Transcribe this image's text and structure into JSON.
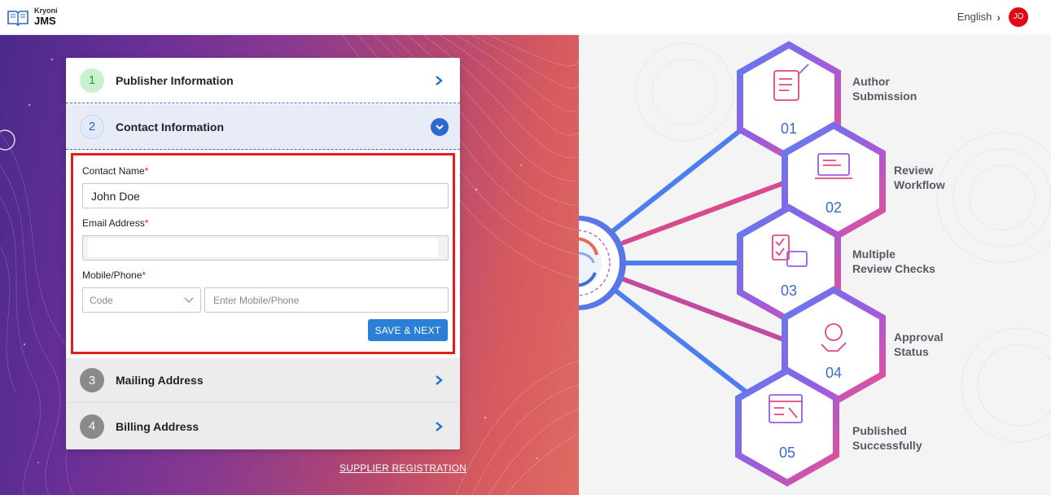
{
  "header": {
    "brand_sub": "Kryoni",
    "brand_main": "JMS",
    "language": "English",
    "avatar_initials": "JO"
  },
  "steps": [
    {
      "number": "1",
      "label": "Publisher Information"
    },
    {
      "number": "2",
      "label": "Contact Information"
    },
    {
      "number": "3",
      "label": "Mailing Address"
    },
    {
      "number": "4",
      "label": "Billing Address"
    }
  ],
  "form": {
    "contact_name_label": "Contact Name",
    "contact_name_value": "John Doe",
    "email_label": "Email Address",
    "email_value": "",
    "phone_label": "Mobile/Phone",
    "code_placeholder": "Code",
    "phone_placeholder": "Enter Mobile/Phone",
    "required_mark": "*",
    "save_label": "SAVE & NEXT"
  },
  "footer_link": "SUPPLIER REGISTRATION",
  "workflow": [
    {
      "num": "01",
      "line1": "Author",
      "line2": "Submission",
      "icon": "scroll-quill-icon"
    },
    {
      "num": "02",
      "line1": "Review",
      "line2": "Workflow",
      "icon": "laptop-edit-icon"
    },
    {
      "num": "03",
      "line1": "Multiple",
      "line2": "Review Checks",
      "icon": "checklist-calendar-icon"
    },
    {
      "num": "04",
      "line1": "Approval",
      "line2": "Status",
      "icon": "handshake-gear-icon"
    },
    {
      "num": "05",
      "line1": "Published",
      "line2": "Successfully",
      "icon": "webpage-icon"
    }
  ],
  "colors": {
    "accent": "#2b7fd6",
    "highlight_border": "#e11d1d",
    "avatar": "#e30613"
  }
}
